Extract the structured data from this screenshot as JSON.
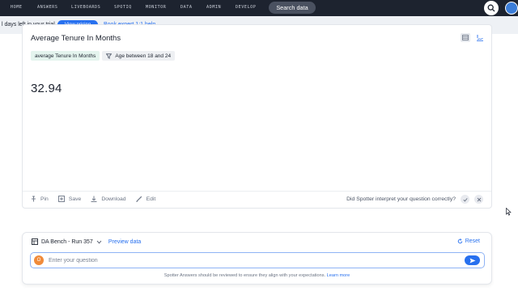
{
  "nav": {
    "items": [
      "HOME",
      "ANSWERS",
      "LIVEBOARDS",
      "SPOTIQ",
      "MONITOR",
      "DATA",
      "ADMIN",
      "DEVELOP"
    ],
    "search_label": "Search data"
  },
  "banner": {
    "text": "l days left in your trial.",
    "cta_label": "View pricing",
    "link_label": "Book expert 1:1 help"
  },
  "answer": {
    "title": "Average Tenure In Months",
    "chips": {
      "measure": "average Tenure In Months",
      "filter": "Age between 18 and 24"
    },
    "value": "32.94",
    "actions": {
      "pin": "Pin",
      "save": "Save",
      "download": "Download",
      "edit": "Edit"
    },
    "feedback_question": "Did Spotter interpret your question correctly?"
  },
  "spotter": {
    "dataset": "DA Bench - Run 357",
    "preview_label": "Preview data",
    "reset_label": "Reset",
    "avatar_initial": "O",
    "input_placeholder": "Enter your question",
    "disclaimer": "Spotter Answers should be reviewed to ensure they align with your expectations.",
    "learn_more": "Learn more"
  },
  "colors": {
    "nav_bg": "#1d232f",
    "accent": "#2770ef",
    "chip_measure_bg": "#e4f4ee",
    "avatar": "#f08a3a"
  }
}
